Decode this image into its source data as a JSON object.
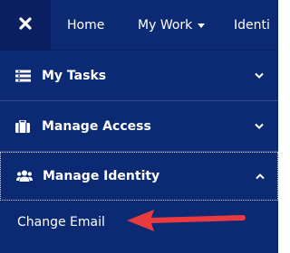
{
  "topnav": {
    "items": [
      {
        "label": "Home"
      },
      {
        "label": "My Work"
      },
      {
        "label": "Identi"
      }
    ]
  },
  "sidebar": {
    "sections": [
      {
        "label": "My Tasks",
        "icon": "task-list-icon",
        "expanded": false
      },
      {
        "label": "Manage Access",
        "icon": "briefcase-icon",
        "expanded": false
      },
      {
        "label": "Manage Identity",
        "icon": "users-icon",
        "expanded": true
      }
    ],
    "subitems": [
      {
        "label": "Change Email"
      }
    ]
  },
  "colors": {
    "nav_bg": "#0c2a73",
    "close_bg": "#0a2061",
    "text": "#ffffff",
    "arrow": "#e83a3f"
  }
}
